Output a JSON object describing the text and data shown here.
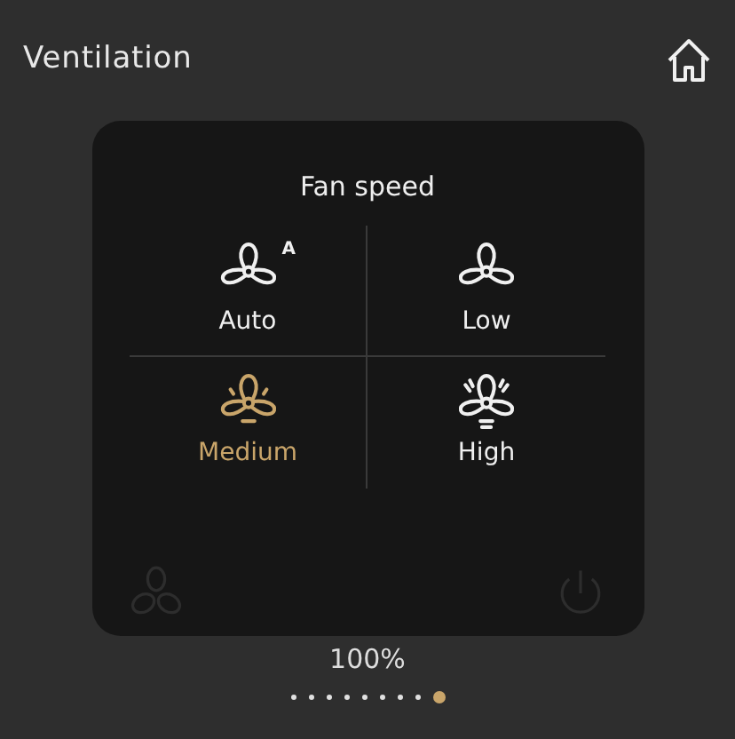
{
  "header": {
    "title": "Ventilation"
  },
  "fan_speed": {
    "title": "Fan speed",
    "options": [
      {
        "label": "Auto",
        "kind": "auto",
        "badge": "A",
        "selected": false
      },
      {
        "label": "Low",
        "kind": "low",
        "selected": false
      },
      {
        "label": "Medium",
        "kind": "medium",
        "selected": true
      },
      {
        "label": "High",
        "kind": "high",
        "selected": false
      }
    ]
  },
  "level_text": "100%",
  "pages": [
    {
      "selected": false
    },
    {
      "selected": false
    },
    {
      "selected": false
    },
    {
      "selected": false
    },
    {
      "selected": false
    },
    {
      "selected": false
    },
    {
      "selected": false
    },
    {
      "selected": false
    },
    {
      "selected": true
    }
  ]
}
